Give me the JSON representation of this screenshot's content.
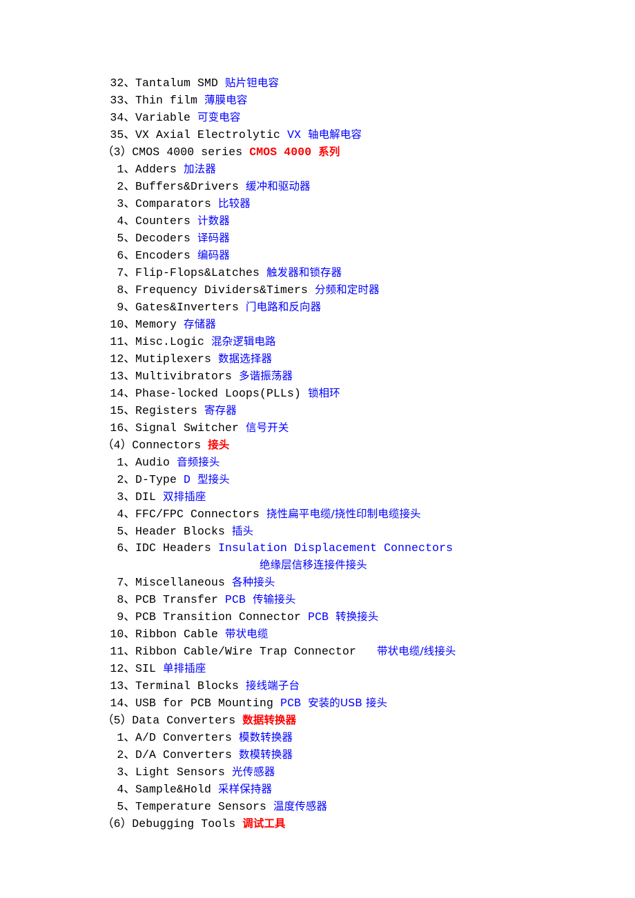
{
  "document": {
    "type": "electronic-component-category-outline",
    "colors": {
      "english_term": "#000000",
      "chinese_translation": "#0000ff",
      "group_heading_chinese": "#ff0000",
      "page_background": "#ffffff"
    },
    "separator": "、",
    "group_paren_open": "（",
    "group_paren_close": "）"
  },
  "content": {
    "continued_items": [
      {
        "num": "32",
        "en": "Tantalum SMD",
        "zh": "贴片钽电容"
      },
      {
        "num": "33",
        "en": "Thin film",
        "zh": "薄膜电容"
      },
      {
        "num": "34",
        "en": "Variable",
        "zh": "可变电容"
      },
      {
        "num": "35",
        "en": "VX Axial Electrolytic",
        "zh_en_prefix": "VX",
        "zh": "轴电解电容"
      }
    ],
    "groups": [
      {
        "marker": "3",
        "en": "CMOS 4000 series",
        "zh_en_prefix": "CMOS 4000",
        "zh": "系列",
        "items": [
          {
            "num": "1",
            "en": "Adders",
            "zh": "加法器"
          },
          {
            "num": "2",
            "en": "Buffers&Drivers",
            "zh": "缓冲和驱动器"
          },
          {
            "num": "3",
            "en": "Comparators",
            "zh": "比较器"
          },
          {
            "num": "4",
            "en": "Counters",
            "zh": "计数器"
          },
          {
            "num": "5",
            "en": "Decoders",
            "zh": "译码器"
          },
          {
            "num": "6",
            "en": "Encoders",
            "zh": "编码器"
          },
          {
            "num": "7",
            "en": "Flip-Flops&Latches",
            "zh": "触发器和锁存器"
          },
          {
            "num": "8",
            "en": "Frequency Dividers&Timers",
            "zh": "分频和定时器"
          },
          {
            "num": "9",
            "en": "Gates&Inverters",
            "zh": "门电路和反向器"
          },
          {
            "num": "10",
            "en": "Memory",
            "zh": "存储器"
          },
          {
            "num": "11",
            "en": "Misc.Logic",
            "zh": "混杂逻辑电路"
          },
          {
            "num": "12",
            "en": "Mutiplexers",
            "zh": "数据选择器"
          },
          {
            "num": "13",
            "en": "Multivibrators",
            "zh": "多谐振荡器"
          },
          {
            "num": "14",
            "en": "Phase-locked Loops(PLLs)",
            "zh": "锁相环"
          },
          {
            "num": "15",
            "en": "Registers",
            "zh": "寄存器"
          },
          {
            "num": "16",
            "en": "Signal Switcher",
            "zh": "信号开关"
          }
        ]
      },
      {
        "marker": "4",
        "en": "Connectors",
        "zh": "接头",
        "items": [
          {
            "num": "1",
            "en": "Audio",
            "zh": "音频接头"
          },
          {
            "num": "2",
            "en": "D-Type",
            "zh_en_prefix": "D",
            "zh": "型接头"
          },
          {
            "num": "3",
            "en": "DIL",
            "zh": "双排插座"
          },
          {
            "num": "4",
            "en": "FFC/FPC Connectors",
            "zh": "挠性扁平电缆/挠性印制电缆接头"
          },
          {
            "num": "5",
            "en": "Header Blocks",
            "zh": "插头"
          },
          {
            "num": "6",
            "en": "IDC Headers",
            "zh_en_prefix": "Insulation Displacement Connectors",
            "zh": "绝缘层信移连接件接头",
            "wrapped": true
          },
          {
            "num": "7",
            "en": "Miscellaneous",
            "zh": "各种接头"
          },
          {
            "num": "8",
            "en": "PCB Transfer",
            "zh_en_prefix": "PCB",
            "zh": "传输接头"
          },
          {
            "num": "9",
            "en": "PCB Transition Connector",
            "zh_en_prefix": "PCB",
            "zh": "转换接头"
          },
          {
            "num": "10",
            "en": "Ribbon Cable",
            "zh": "带状电缆"
          },
          {
            "num": "11",
            "en": "Ribbon Cable/Wire Trap Connector",
            "zh": "带状电缆/线接头",
            "wide_gap": true
          },
          {
            "num": "12",
            "en": "SIL",
            "zh": "单排插座"
          },
          {
            "num": "13",
            "en": "Terminal Blocks",
            "zh": "接线端子台"
          },
          {
            "num": "14",
            "en": "USB for PCB Mounting",
            "zh_en_prefix": "PCB",
            "zh": "安装的USB 接头"
          }
        ]
      },
      {
        "marker": "5",
        "en": "Data Converters",
        "zh": "数据转换器",
        "items": [
          {
            "num": "1",
            "en": "A/D Converters",
            "zh": "模数转换器"
          },
          {
            "num": "2",
            "en": "D/A Converters",
            "zh": "数模转换器"
          },
          {
            "num": "3",
            "en": "Light Sensors",
            "zh": "光传感器"
          },
          {
            "num": "4",
            "en": "Sample&Hold",
            "zh": "采样保持器"
          },
          {
            "num": "5",
            "en": "Temperature Sensors",
            "zh": "温度传感器"
          }
        ]
      },
      {
        "marker": "6",
        "en": "Debugging Tools",
        "zh": "调试工具",
        "items": []
      }
    ]
  }
}
